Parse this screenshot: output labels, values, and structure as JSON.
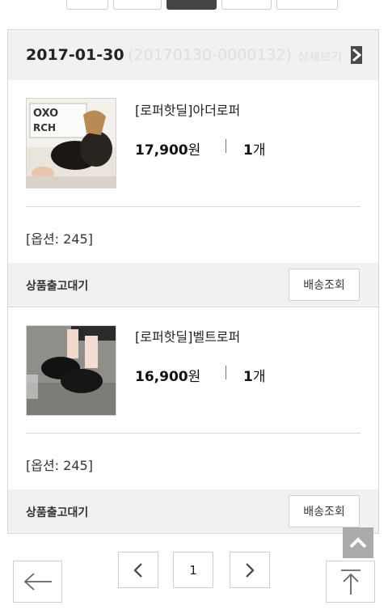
{
  "orders": [
    {
      "date": "2017-01-30",
      "order_no": "(20170130-0000132)",
      "detail_label": "상세보기",
      "items": [
        {
          "name": "[로퍼핫딜]아더로퍼",
          "price": "17,900",
          "currency": "원",
          "qty": "1",
          "qty_unit": "개",
          "option": "[옵션: 245]",
          "status": "상품출고대기",
          "track_label": "배송조회",
          "image_icon": "shoe-photo-box"
        },
        {
          "name": "[로퍼핫딜]벨트로퍼",
          "price": "16,900",
          "currency": "원",
          "qty": "1",
          "qty_unit": "개",
          "option": "[옵션: 245]",
          "status": "상품출고대기",
          "track_label": "배송조회",
          "image_icon": "shoe-photo-floor"
        }
      ]
    }
  ],
  "pagination": {
    "current_page": "1",
    "prev_icon": "chevron-left-icon",
    "next_icon": "chevron-right-icon"
  },
  "bottom_nav": {
    "back_icon": "arrow-left-icon",
    "top_icon": "arrow-up-icon"
  },
  "colors": {
    "header_bg": "#f1f1f1",
    "active_tab": "#444444",
    "border": "#d6d6d6"
  }
}
